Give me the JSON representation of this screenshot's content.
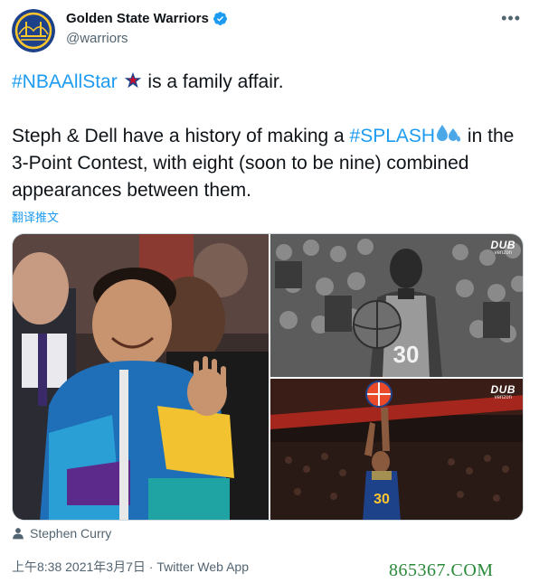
{
  "account": {
    "display_name": "Golden State Warriors",
    "handle": "@warriors"
  },
  "tweet": {
    "hashtag1": "#NBAAllStar",
    "line1_rest": " is a family affair.",
    "line2_pre": "Steph & Dell have a history of making a ",
    "hashtag2": "#SPLASH",
    "line2_post": " in the 3-Point Contest, with eight (soon to be nine) combined appearances between them."
  },
  "translate_label": "翻译推文",
  "media": {
    "tr_badge": {
      "brand": "DUB",
      "sub": "verizon"
    },
    "br_badge": {
      "brand": "DUB",
      "sub": "verizon"
    },
    "jersey_number": "30"
  },
  "tagged_person": "Stephen Curry",
  "meta": {
    "time": "上午8:38",
    "date": "2021年3月7日",
    "source": "Twitter Web App",
    "separator": " · "
  },
  "watermark": "865367.COM",
  "colors": {
    "link": "#1d9bf0",
    "secondary": "#536471",
    "warriors_blue": "#1d428a",
    "warriors_gold": "#ffc72c"
  },
  "icons": [
    "warriors-logo-icon",
    "verified-badge-icon",
    "more-icon",
    "allstar-emoji-icon",
    "splash-emoji-icon",
    "person-tag-icon"
  ]
}
